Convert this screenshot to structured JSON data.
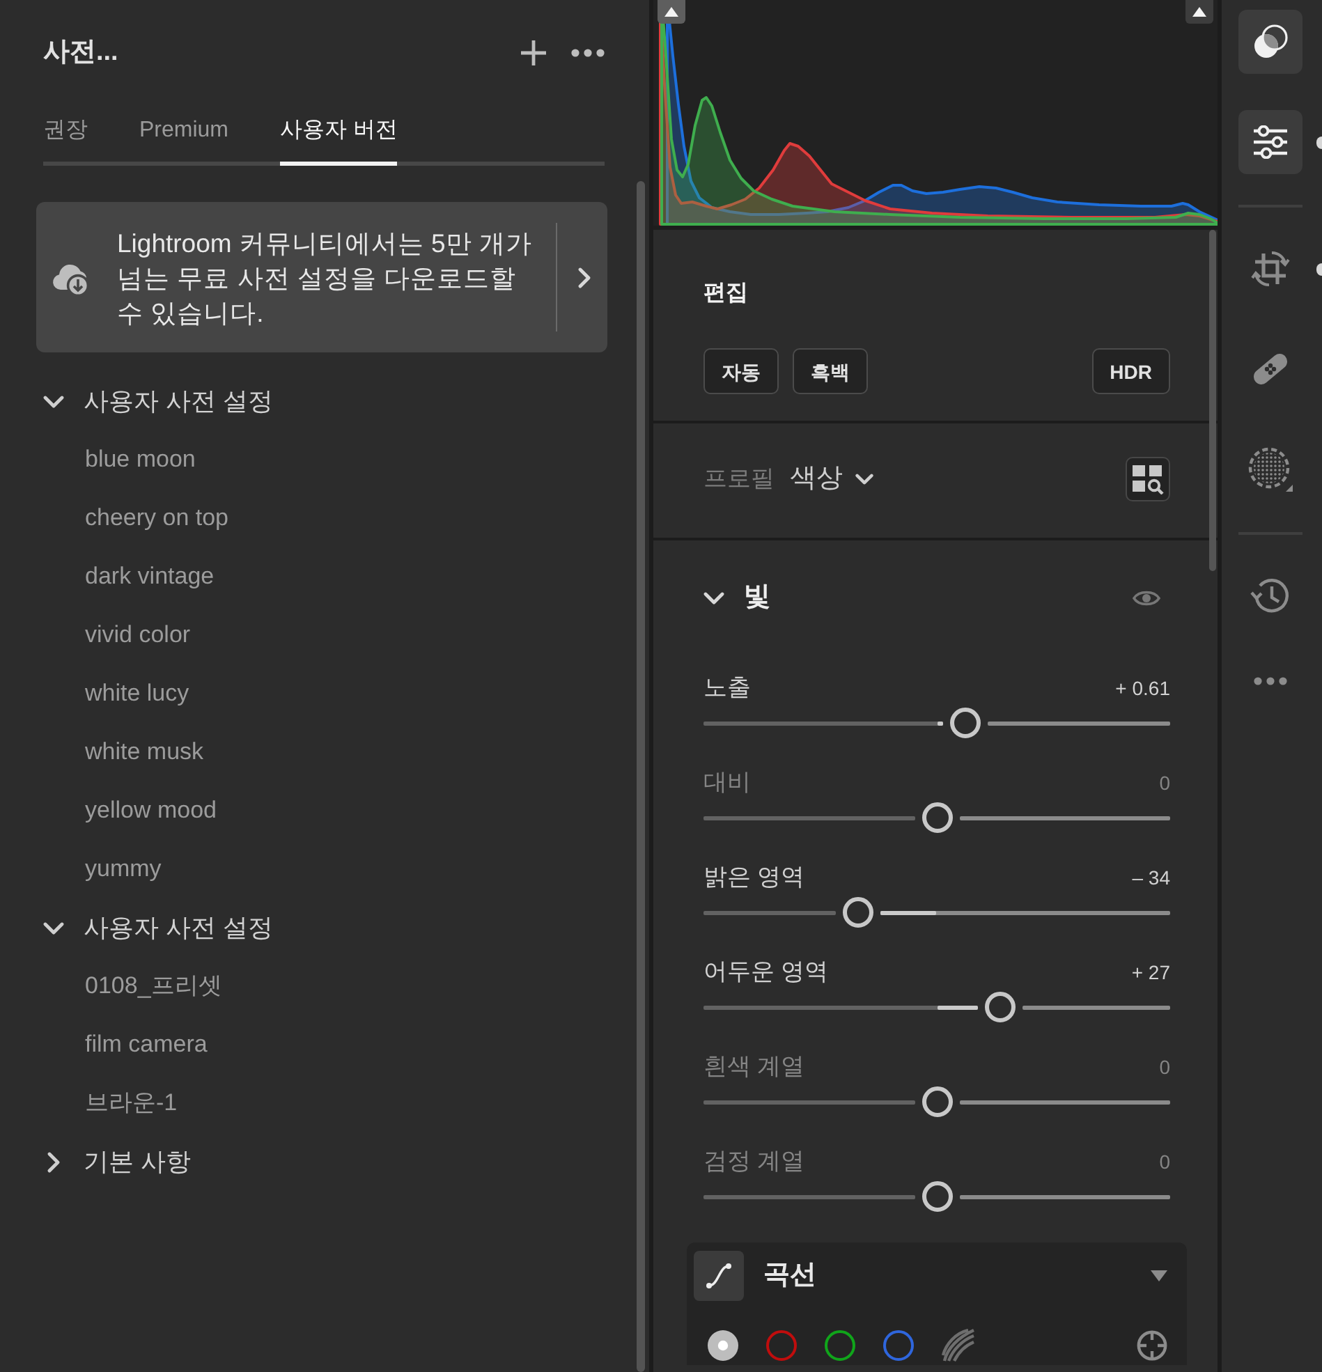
{
  "presets_panel": {
    "title": "사전...",
    "tabs": [
      {
        "label": "권장",
        "selected": false
      },
      {
        "label": "Premium",
        "selected": false
      },
      {
        "label": "사용자 버전",
        "selected": true
      }
    ],
    "promo": {
      "text": "Lightroom 커뮤니티에서는 5만 개가 넘는 무료 사전 설정을 다운로드할 수 있습니다."
    },
    "groups": [
      {
        "label": "사용자 사전 설정",
        "expanded": true,
        "children": [
          {
            "label": "blue moon",
            "selected": false
          },
          {
            "label": "cheery on top",
            "selected": false
          },
          {
            "label": "dark vintage",
            "selected": false
          },
          {
            "label": "vivid color",
            "selected": false
          },
          {
            "label": "white lucy",
            "selected": false
          },
          {
            "label": "white musk",
            "selected": false
          },
          {
            "label": "yellow mood",
            "selected": false
          },
          {
            "label": "yummy",
            "selected": false
          }
        ]
      },
      {
        "label": "사용자 사전 설정",
        "expanded": true,
        "children": [
          {
            "label": "0108_프리셋",
            "selected": false
          },
          {
            "label": "film camera",
            "selected": false
          },
          {
            "label": "브라운-1",
            "selected": false
          }
        ]
      },
      {
        "label": "기본 사항",
        "expanded": false
      }
    ]
  },
  "histogram": {
    "channels": [
      {
        "color": "#3fae4e"
      },
      {
        "color": "#e03c3c"
      },
      {
        "color": "#1d6fdc"
      }
    ]
  },
  "edit_panel": {
    "title": "편집",
    "buttons": [
      {
        "label": "자동"
      },
      {
        "label": "흑백"
      }
    ],
    "hdr_button": {
      "label": "HDR"
    },
    "profile": {
      "label": "프로필",
      "value": "색상"
    },
    "light": {
      "title": "빛",
      "expanded": true,
      "sliders": [
        {
          "label": "노출",
          "reading": "+ 0.61",
          "level": 0.561,
          "modified": true
        },
        {
          "label": "대비",
          "reading": "0",
          "level": 0.5,
          "modified": false
        },
        {
          "label": "밝은 영역",
          "reading": "– 34",
          "level": 0.33,
          "modified": true
        },
        {
          "label": "어두운 영역",
          "reading": "+ 27",
          "level": 0.635,
          "modified": true
        },
        {
          "label": "흰색 계열",
          "reading": "0",
          "level": 0.5,
          "modified": false
        },
        {
          "label": "검정 계열",
          "reading": "0",
          "level": 0.5,
          "modified": false
        }
      ]
    },
    "curve": {
      "title": "곡선",
      "channels": [
        {
          "kind": "point",
          "color": "#bdbdbd",
          "selected": true
        },
        {
          "kind": "channel",
          "color": "#c00d0d",
          "selected": false
        },
        {
          "kind": "channel",
          "color": "#10a51a",
          "selected": false
        },
        {
          "kind": "channel",
          "color": "#2f66dd",
          "selected": false
        },
        {
          "kind": "parametric",
          "selected": false
        }
      ]
    }
  },
  "toolbar": {
    "groups": [
      {
        "tools": [
          {
            "kind": "presets",
            "selected": true,
            "edited": false
          },
          {
            "kind": "edit",
            "selected": true,
            "edited": true
          }
        ]
      },
      {
        "tools": [
          {
            "kind": "crop",
            "selected": false,
            "edited": true
          },
          {
            "kind": "healing",
            "selected": false,
            "edited": false
          },
          {
            "kind": "masking",
            "selected": false,
            "edited": false
          }
        ]
      },
      {
        "tools": [
          {
            "kind": "history",
            "selected": false,
            "edited": false
          },
          {
            "kind": "more",
            "selected": false,
            "edited": false
          }
        ]
      }
    ]
  }
}
